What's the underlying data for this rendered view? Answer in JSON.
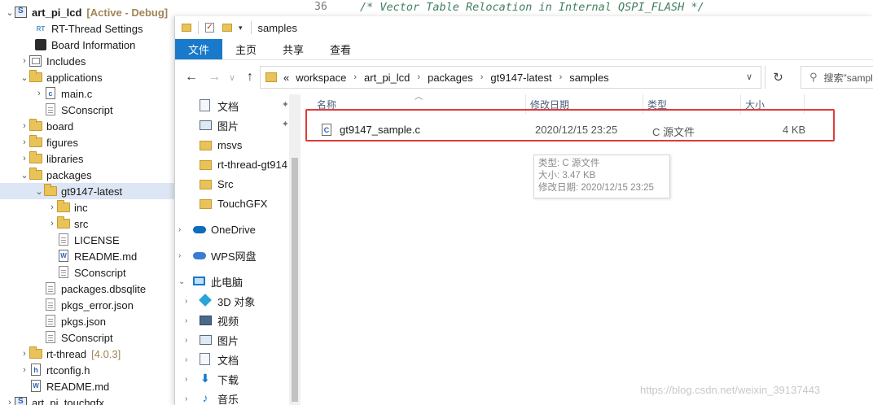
{
  "explorer": {
    "rows": [
      {
        "label": "art_pi_lcd",
        "decoration": "[Active - Debug]",
        "bold": true,
        "icon": "project-icon",
        "toggle": "v"
      },
      {
        "label": "RT-Thread Settings",
        "icon": "rt-settings-icon",
        "toggle": ""
      },
      {
        "label": "Board Information",
        "icon": "board-info-icon",
        "toggle": ""
      },
      {
        "label": "Includes",
        "icon": "includes-icon",
        "toggle": ">"
      },
      {
        "label": "applications",
        "icon": "folder-icon",
        "toggle": "v"
      },
      {
        "label": "main.c",
        "icon": "c-file-icon",
        "toggle": ">"
      },
      {
        "label": "SConscript",
        "icon": "file-icon",
        "toggle": ""
      },
      {
        "label": "board",
        "icon": "folder-icon",
        "toggle": ">"
      },
      {
        "label": "figures",
        "icon": "folder-icon",
        "toggle": ">"
      },
      {
        "label": "libraries",
        "icon": "folder-icon",
        "toggle": ">"
      },
      {
        "label": "packages",
        "icon": "folder-icon",
        "toggle": "v"
      },
      {
        "label": "gt9147-latest",
        "icon": "folder-icon",
        "toggle": "v",
        "selected": true
      },
      {
        "label": "inc",
        "icon": "folder-icon",
        "toggle": ">"
      },
      {
        "label": "src",
        "icon": "folder-icon",
        "toggle": ">"
      },
      {
        "label": "LICENSE",
        "icon": "file-icon",
        "toggle": ""
      },
      {
        "label": "README.md",
        "icon": "markdown-file-icon",
        "toggle": ""
      },
      {
        "label": "SConscript",
        "icon": "file-icon",
        "toggle": ""
      },
      {
        "label": "packages.dbsqlite",
        "icon": "file-icon",
        "toggle": ""
      },
      {
        "label": "pkgs_error.json",
        "icon": "file-icon",
        "toggle": ""
      },
      {
        "label": "pkgs.json",
        "icon": "file-icon",
        "toggle": ""
      },
      {
        "label": "SConscript",
        "icon": "file-icon",
        "toggle": ""
      },
      {
        "label": "rt-thread",
        "decoration": "[4.0.3]",
        "icon": "folder-icon",
        "toggle": ">"
      },
      {
        "label": "rtconfig.h",
        "icon": "h-file-icon",
        "toggle": ">"
      },
      {
        "label": "README.md",
        "icon": "markdown-file-icon",
        "toggle": ""
      },
      {
        "label": "art_pi_touchgfx",
        "icon": "project-icon",
        "toggle": ">"
      }
    ]
  },
  "editor": {
    "line_number": "36",
    "code": "/* Vector Table Relocation in Internal QSPI_FLASH */"
  },
  "window": {
    "title": "samples",
    "ribbon_tabs": [
      "文件",
      "主页",
      "共享",
      "查看"
    ],
    "breadcrumb": [
      "«",
      "workspace",
      "art_pi_lcd",
      "packages",
      "gt9147-latest",
      "samples"
    ],
    "search_placeholder": "搜索\"samples\""
  },
  "nav": {
    "items": [
      {
        "label": "文档",
        "icon": "documents-icon",
        "pinned": true
      },
      {
        "label": "图片",
        "icon": "pictures-icon",
        "pinned": true
      },
      {
        "label": "msvs",
        "icon": "folder-icon"
      },
      {
        "label": "rt-thread-gt914",
        "icon": "folder-icon"
      },
      {
        "label": "Src",
        "icon": "folder-icon"
      },
      {
        "label": "TouchGFX",
        "icon": "folder-icon"
      },
      {
        "label": "OneDrive",
        "icon": "onedrive-icon",
        "expand": ">"
      },
      {
        "label": "WPS网盘",
        "icon": "wps-cloud-icon",
        "expand": ">"
      },
      {
        "label": "此电脑",
        "icon": "this-pc-icon",
        "expand": "v"
      },
      {
        "label": "3D 对象",
        "icon": "3d-objects-icon",
        "expand": ">"
      },
      {
        "label": "视频",
        "icon": "videos-icon",
        "expand": ">"
      },
      {
        "label": "图片",
        "icon": "pictures-icon",
        "expand": ">"
      },
      {
        "label": "文档",
        "icon": "documents-icon",
        "expand": ">"
      },
      {
        "label": "下载",
        "icon": "downloads-icon",
        "expand": ">"
      },
      {
        "label": "音乐",
        "icon": "music-icon",
        "expand": ">"
      }
    ]
  },
  "filelist": {
    "columns": [
      "名称",
      "修改日期",
      "类型",
      "大小"
    ],
    "files": [
      {
        "name": "gt9147_sample.c",
        "date": "2020/12/15 23:25",
        "type": "C 源文件",
        "size": "4 KB"
      }
    ],
    "tooltip": [
      "类型: C 源文件",
      "大小: 3.47 KB",
      "修改日期: 2020/12/15 23:25"
    ]
  },
  "watermark": "https://blog.csdn.net/weixin_39137443",
  "colors": {
    "accent": "#1979ca",
    "highlight_border": "#e03a3a",
    "selection": "#dce6f4"
  }
}
